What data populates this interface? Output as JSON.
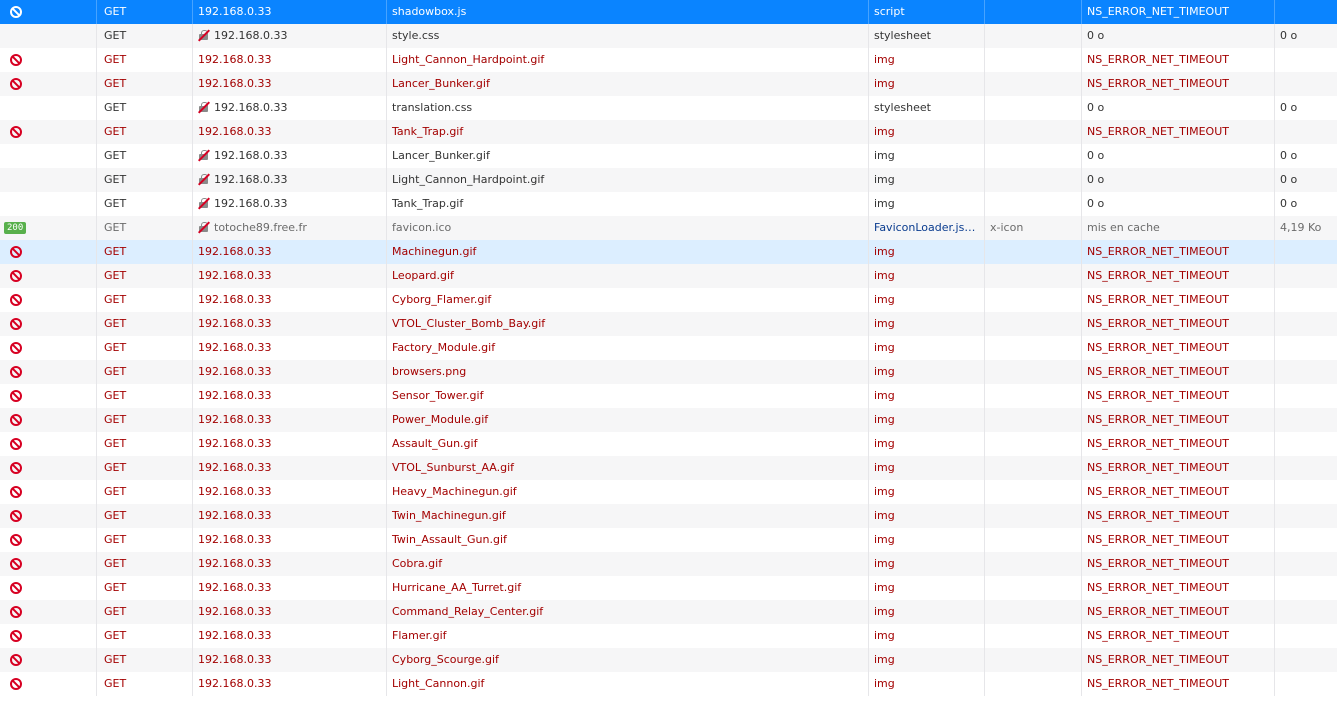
{
  "rows": [
    {
      "state": "blocked",
      "method": "GET",
      "domain": "192.168.0.33",
      "insecure": false,
      "file": "shadowbox.js",
      "cause": "script",
      "type": "",
      "transferred": "NS_ERROR_NET_TIMEOUT",
      "size": ""
    },
    {
      "state": "normal",
      "method": "GET",
      "domain": "192.168.0.33",
      "insecure": true,
      "file": "style.css",
      "cause": "stylesheet",
      "type": "",
      "transferred": "0 o",
      "size": "0 o"
    },
    {
      "state": "blocked",
      "method": "GET",
      "domain": "192.168.0.33",
      "insecure": false,
      "file": "Light_Cannon_Hardpoint.gif",
      "cause": "img",
      "type": "",
      "transferred": "NS_ERROR_NET_TIMEOUT",
      "size": ""
    },
    {
      "state": "blocked",
      "method": "GET",
      "domain": "192.168.0.33",
      "insecure": false,
      "file": "Lancer_Bunker.gif",
      "cause": "img",
      "type": "",
      "transferred": "NS_ERROR_NET_TIMEOUT",
      "size": ""
    },
    {
      "state": "normal",
      "method": "GET",
      "domain": "192.168.0.33",
      "insecure": true,
      "file": "translation.css",
      "cause": "stylesheet",
      "type": "",
      "transferred": "0 o",
      "size": "0 o"
    },
    {
      "state": "blocked",
      "method": "GET",
      "domain": "192.168.0.33",
      "insecure": false,
      "file": "Tank_Trap.gif",
      "cause": "img",
      "type": "",
      "transferred": "NS_ERROR_NET_TIMEOUT",
      "size": ""
    },
    {
      "state": "normal",
      "method": "GET",
      "domain": "192.168.0.33",
      "insecure": true,
      "file": "Lancer_Bunker.gif",
      "cause": "img",
      "type": "",
      "transferred": "0 o",
      "size": "0 o"
    },
    {
      "state": "normal",
      "method": "GET",
      "domain": "192.168.0.33",
      "insecure": true,
      "file": "Light_Cannon_Hardpoint.gif",
      "cause": "img",
      "type": "",
      "transferred": "0 o",
      "size": "0 o"
    },
    {
      "state": "normal",
      "method": "GET",
      "domain": "192.168.0.33",
      "insecure": true,
      "file": "Tank_Trap.gif",
      "cause": "img",
      "type": "",
      "transferred": "0 o",
      "size": "0 o"
    },
    {
      "state": "cached",
      "status": "200",
      "method": "GET",
      "domain": "totoche89.free.fr",
      "insecure": true,
      "file": "favicon.ico",
      "cause": "FaviconLoader.jsm...",
      "type": "x-icon",
      "transferred": "mis en cache",
      "size": "4,19 Ko"
    },
    {
      "state": "blocked",
      "method": "GET",
      "domain": "192.168.0.33",
      "insecure": false,
      "file": "Machinegun.gif",
      "cause": "img",
      "type": "",
      "transferred": "NS_ERROR_NET_TIMEOUT",
      "size": ""
    },
    {
      "state": "blocked",
      "method": "GET",
      "domain": "192.168.0.33",
      "insecure": false,
      "file": "Leopard.gif",
      "cause": "img",
      "type": "",
      "transferred": "NS_ERROR_NET_TIMEOUT",
      "size": ""
    },
    {
      "state": "blocked",
      "method": "GET",
      "domain": "192.168.0.33",
      "insecure": false,
      "file": "Cyborg_Flamer.gif",
      "cause": "img",
      "type": "",
      "transferred": "NS_ERROR_NET_TIMEOUT",
      "size": ""
    },
    {
      "state": "blocked",
      "method": "GET",
      "domain": "192.168.0.33",
      "insecure": false,
      "file": "VTOL_Cluster_Bomb_Bay.gif",
      "cause": "img",
      "type": "",
      "transferred": "NS_ERROR_NET_TIMEOUT",
      "size": ""
    },
    {
      "state": "blocked",
      "method": "GET",
      "domain": "192.168.0.33",
      "insecure": false,
      "file": "Factory_Module.gif",
      "cause": "img",
      "type": "",
      "transferred": "NS_ERROR_NET_TIMEOUT",
      "size": ""
    },
    {
      "state": "blocked",
      "method": "GET",
      "domain": "192.168.0.33",
      "insecure": false,
      "file": "browsers.png",
      "cause": "img",
      "type": "",
      "transferred": "NS_ERROR_NET_TIMEOUT",
      "size": ""
    },
    {
      "state": "blocked",
      "method": "GET",
      "domain": "192.168.0.33",
      "insecure": false,
      "file": "Sensor_Tower.gif",
      "cause": "img",
      "type": "",
      "transferred": "NS_ERROR_NET_TIMEOUT",
      "size": ""
    },
    {
      "state": "blocked",
      "method": "GET",
      "domain": "192.168.0.33",
      "insecure": false,
      "file": "Power_Module.gif",
      "cause": "img",
      "type": "",
      "transferred": "NS_ERROR_NET_TIMEOUT",
      "size": ""
    },
    {
      "state": "blocked",
      "method": "GET",
      "domain": "192.168.0.33",
      "insecure": false,
      "file": "Assault_Gun.gif",
      "cause": "img",
      "type": "",
      "transferred": "NS_ERROR_NET_TIMEOUT",
      "size": ""
    },
    {
      "state": "blocked",
      "method": "GET",
      "domain": "192.168.0.33",
      "insecure": false,
      "file": "VTOL_Sunburst_AA.gif",
      "cause": "img",
      "type": "",
      "transferred": "NS_ERROR_NET_TIMEOUT",
      "size": ""
    },
    {
      "state": "blocked",
      "method": "GET",
      "domain": "192.168.0.33",
      "insecure": false,
      "file": "Heavy_Machinegun.gif",
      "cause": "img",
      "type": "",
      "transferred": "NS_ERROR_NET_TIMEOUT",
      "size": ""
    },
    {
      "state": "blocked",
      "method": "GET",
      "domain": "192.168.0.33",
      "insecure": false,
      "file": "Twin_Machinegun.gif",
      "cause": "img",
      "type": "",
      "transferred": "NS_ERROR_NET_TIMEOUT",
      "size": ""
    },
    {
      "state": "blocked",
      "method": "GET",
      "domain": "192.168.0.33",
      "insecure": false,
      "file": "Twin_Assault_Gun.gif",
      "cause": "img",
      "type": "",
      "transferred": "NS_ERROR_NET_TIMEOUT",
      "size": ""
    },
    {
      "state": "blocked",
      "method": "GET",
      "domain": "192.168.0.33",
      "insecure": false,
      "file": "Cobra.gif",
      "cause": "img",
      "type": "",
      "transferred": "NS_ERROR_NET_TIMEOUT",
      "size": ""
    },
    {
      "state": "blocked",
      "method": "GET",
      "domain": "192.168.0.33",
      "insecure": false,
      "file": "Hurricane_AA_Turret.gif",
      "cause": "img",
      "type": "",
      "transferred": "NS_ERROR_NET_TIMEOUT",
      "size": ""
    },
    {
      "state": "blocked",
      "method": "GET",
      "domain": "192.168.0.33",
      "insecure": false,
      "file": "Command_Relay_Center.gif",
      "cause": "img",
      "type": "",
      "transferred": "NS_ERROR_NET_TIMEOUT",
      "size": ""
    },
    {
      "state": "blocked",
      "method": "GET",
      "domain": "192.168.0.33",
      "insecure": false,
      "file": "Flamer.gif",
      "cause": "img",
      "type": "",
      "transferred": "NS_ERROR_NET_TIMEOUT",
      "size": ""
    },
    {
      "state": "blocked",
      "method": "GET",
      "domain": "192.168.0.33",
      "insecure": false,
      "file": "Cyborg_Scourge.gif",
      "cause": "img",
      "type": "",
      "transferred": "NS_ERROR_NET_TIMEOUT",
      "size": ""
    },
    {
      "state": "blocked",
      "method": "GET",
      "domain": "192.168.0.33",
      "insecure": false,
      "file": "Light_Cannon.gif",
      "cause": "img",
      "type": "",
      "transferred": "NS_ERROR_NET_TIMEOUT",
      "size": ""
    }
  ],
  "selected_row": 0,
  "highlighted_row": 10,
  "colors": {
    "selected_bg": "#0a84ff",
    "highlight_bg": "#dceeff",
    "error_text": "#a30000",
    "blocked_icon": "#d70022",
    "status_200_badge": "#58b04c"
  }
}
